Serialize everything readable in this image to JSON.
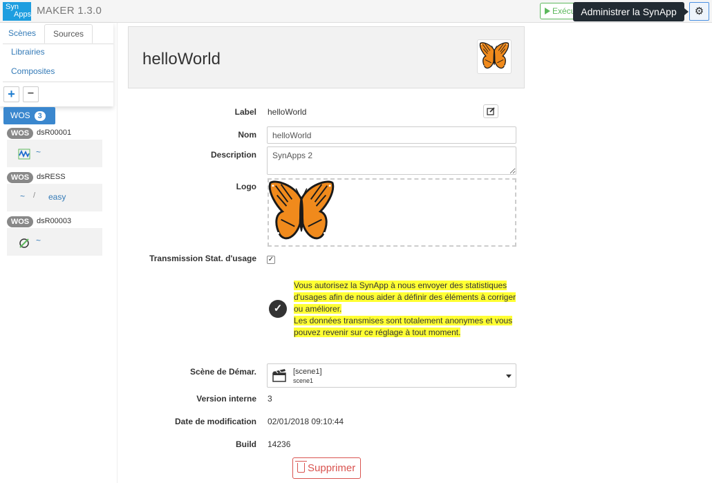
{
  "app": {
    "logo_line1": "Syn",
    "logo_line2": "Apps",
    "name": "MAKER  1.3.0",
    "run_label": "Exécu",
    "tooltip": "Administrer la SynApp",
    "settings_icon": "gear-icon"
  },
  "nav": {
    "tabs": [
      {
        "label": "Scènes"
      },
      {
        "label": "Sources"
      }
    ],
    "links": [
      {
        "label": "Librairies"
      },
      {
        "label": "Composites"
      }
    ],
    "add_label": "+",
    "remove_label": "−"
  },
  "wos": {
    "button_label": "WOS",
    "count": "3",
    "items": [
      {
        "tag": "WOS",
        "name": "dsR00001",
        "tilde": "~"
      },
      {
        "tag": "WOS",
        "name": "dsRESS",
        "tilde": "~",
        "sep": "/",
        "extra": "easy"
      },
      {
        "tag": "WOS",
        "name": "dsR00003",
        "tilde": "~"
      }
    ]
  },
  "header": {
    "title": "helloWorld"
  },
  "form": {
    "label": {
      "caption": "Label",
      "value": "helloWorld"
    },
    "nom": {
      "caption": "Nom",
      "value": "helloWorld"
    },
    "description": {
      "caption": "Description",
      "value": "SynApps 2"
    },
    "logo": {
      "caption": "Logo"
    },
    "stats": {
      "caption": "Transmission Stat. d'usage",
      "checked": true,
      "notice_1": "Vous autorisez la SynApp à nous envoyer des statistiques d'usages afin de nous aider à définir des éléments à corriger ou améliorer.",
      "notice_2": "Les données transmises sont totalement anonymes et vous pouvez revenir sur ce réglage à tout moment."
    },
    "start_scene": {
      "caption": "Scène de Démar.",
      "selected_title": "[scene1]",
      "selected_sub": "scene1"
    },
    "version": {
      "caption": "Version interne",
      "value": "3"
    },
    "modified": {
      "caption": "Date de modification",
      "value": "02/01/2018 09:10:44"
    },
    "build": {
      "caption": "Build",
      "value": "14236"
    },
    "delete_label": "Supprimer"
  },
  "colors": {
    "brand": "#1e9ee0",
    "primary": "#3a87ce",
    "success": "#5cb85c",
    "danger": "#d9534f",
    "highlight": "#ffff33",
    "butterfly_orange": "#f08a1c"
  }
}
